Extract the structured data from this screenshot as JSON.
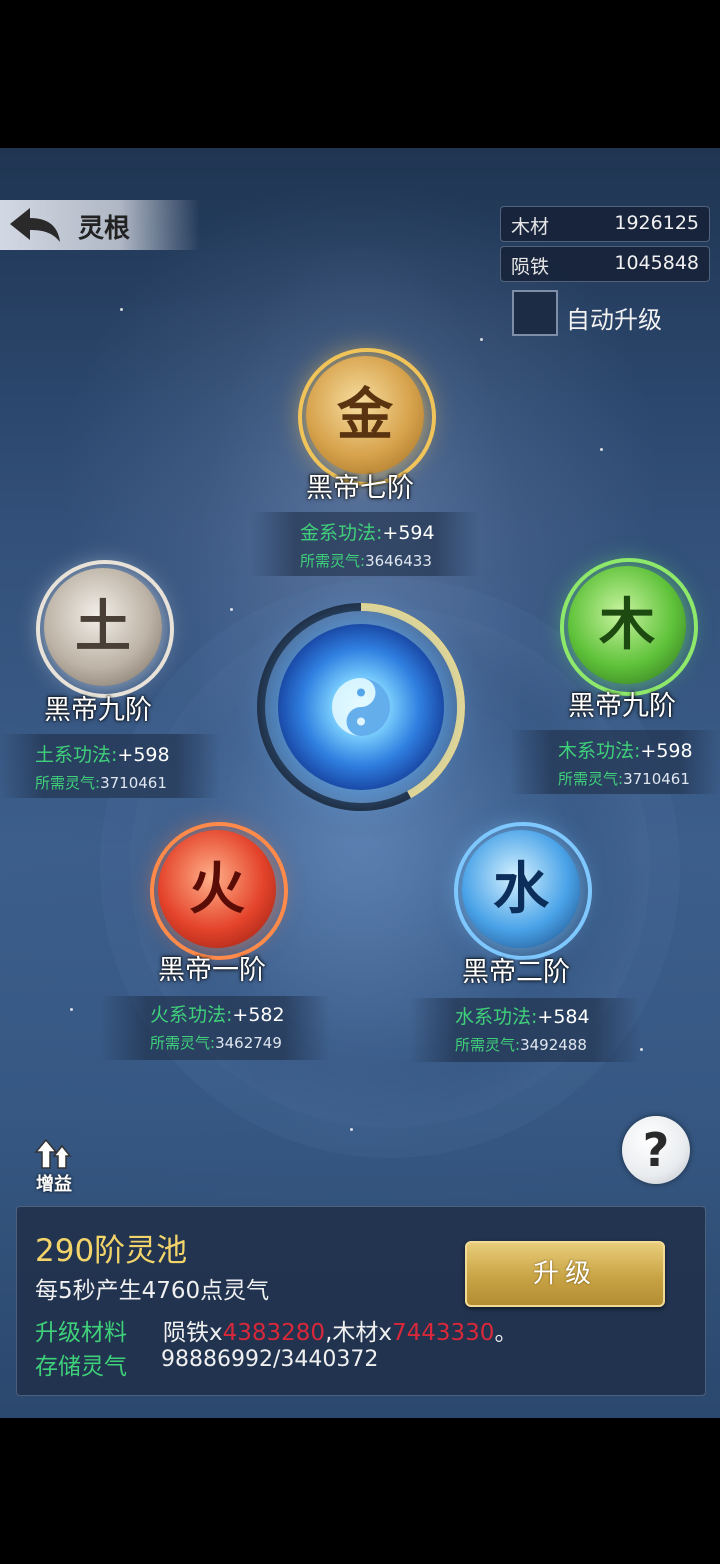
{
  "header": {
    "title": "灵根"
  },
  "resources": [
    {
      "label": "木材",
      "value": "1926125"
    },
    {
      "label": "陨铁",
      "value": "1045848"
    }
  ],
  "auto_upgrade": {
    "label": "自动升级",
    "checked": false
  },
  "elements": {
    "metal": {
      "glyph": "金",
      "rank": "黑帝七阶",
      "skill_label": "金系功法:",
      "skill_value": "+594",
      "need_label": "所需灵气:",
      "need_value": "3646433",
      "color": "#e0a83a"
    },
    "earth": {
      "glyph": "土",
      "rank": "黑帝九阶",
      "skill_label": "土系功法:",
      "skill_value": "+598",
      "need_label": "所需灵气:",
      "need_value": "3710461",
      "color": "#cfc6b8"
    },
    "wood": {
      "glyph": "木",
      "rank": "黑帝九阶",
      "skill_label": "木系功法:",
      "skill_value": "+598",
      "need_label": "所需灵气:",
      "need_value": "3710461",
      "color": "#5fd34a"
    },
    "fire": {
      "glyph": "火",
      "rank": "黑帝一阶",
      "skill_label": "火系功法:",
      "skill_value": "+582",
      "need_label": "所需灵气:",
      "need_value": "3462749",
      "color": "#e8402a"
    },
    "water": {
      "glyph": "水",
      "rank": "黑帝二阶",
      "skill_label": "水系功法:",
      "skill_value": "+584",
      "need_label": "所需灵气:",
      "need_value": "3492488",
      "color": "#4aa8f0"
    }
  },
  "center": {
    "progress": 0.42
  },
  "buff": {
    "label": "增益"
  },
  "help": {
    "label": "?"
  },
  "panel": {
    "title": "290阶灵池",
    "rate": "每5秒产生4760点灵气",
    "materials_label": "升级材料",
    "mat_iron_label": "陨铁x",
    "mat_iron_value": "4383280",
    "mat_wood_label": ",木材x",
    "mat_wood_value": "7443330",
    "mat_end": "。",
    "storage_label": "存储灵气",
    "storage_value": "98886992/3440372",
    "upgrade_label": "升级"
  }
}
